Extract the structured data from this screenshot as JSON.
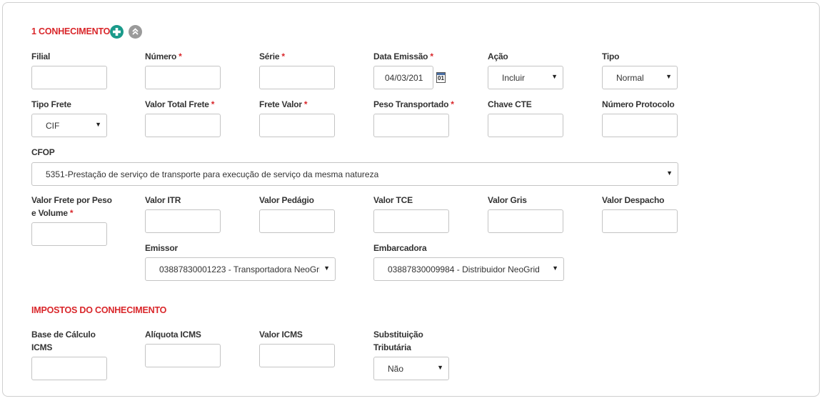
{
  "section1": {
    "title": "1 CONHECIMENTO",
    "add_icon": "plus-circle-icon",
    "collapse_icon": "chevron-double-up-icon"
  },
  "fields": {
    "filial": {
      "label": "Filial",
      "value": ""
    },
    "numero": {
      "label": "Número",
      "required": "*",
      "value": ""
    },
    "serie": {
      "label": "Série",
      "required": "*",
      "value": ""
    },
    "data_emissao": {
      "label": "Data Emissão",
      "required": "*",
      "value": "04/03/201",
      "calendar_icon_text": "01"
    },
    "acao": {
      "label": "Ação",
      "value": "Incluir"
    },
    "tipo": {
      "label": "Tipo",
      "value": "Normal"
    },
    "tipo_frete": {
      "label": "Tipo Frete",
      "value": "CIF"
    },
    "valor_total_frete": {
      "label": "Valor Total Frete",
      "required": "*",
      "value": ""
    },
    "frete_valor": {
      "label": "Frete Valor",
      "required": "*",
      "value": ""
    },
    "peso_transportado": {
      "label": "Peso Transportado",
      "required": "*",
      "value": ""
    },
    "chave_cte": {
      "label": "Chave CTE",
      "value": ""
    },
    "numero_protocolo": {
      "label": "Número Protocolo",
      "value": ""
    },
    "cfop": {
      "label": "CFOP",
      "value": "5351-Prestação de serviço de transporte para execução de serviço da mesma natureza"
    },
    "valor_frete_peso_volume": {
      "label_line1": "Valor Frete por Peso",
      "label_line2": "e Volume",
      "required": "*",
      "value": ""
    },
    "valor_itr": {
      "label": "Valor ITR",
      "value": ""
    },
    "valor_pedagio": {
      "label": "Valor Pedágio",
      "value": ""
    },
    "valor_tce": {
      "label": "Valor TCE",
      "value": ""
    },
    "valor_gris": {
      "label": "Valor Gris",
      "value": ""
    },
    "valor_despacho": {
      "label": "Valor Despacho",
      "value": ""
    },
    "emissor": {
      "label": "Emissor",
      "value": "03887830001223 - Transportadora NeoGri"
    },
    "embarcadora": {
      "label": "Embarcadora",
      "value": "03887830009984 - Distribuidor NeoGrid"
    }
  },
  "section2": {
    "title": "IMPOSTOS DO CONHECIMENTO"
  },
  "impostos": {
    "base_calculo_icms": {
      "label_line1": "Base de Cálculo",
      "label_line2": "ICMS",
      "value": ""
    },
    "aliquota_icms": {
      "label": "Alíquota ICMS",
      "value": ""
    },
    "valor_icms": {
      "label": "Valor ICMS",
      "value": ""
    },
    "substituicao_tributaria": {
      "label_line1": "Substituição",
      "label_line2": "Tributária",
      "value": "Não"
    }
  },
  "colors": {
    "accent_red": "#d9262a",
    "add_green": "#1a9a8a",
    "collapse_gray": "#9a9a9a"
  }
}
